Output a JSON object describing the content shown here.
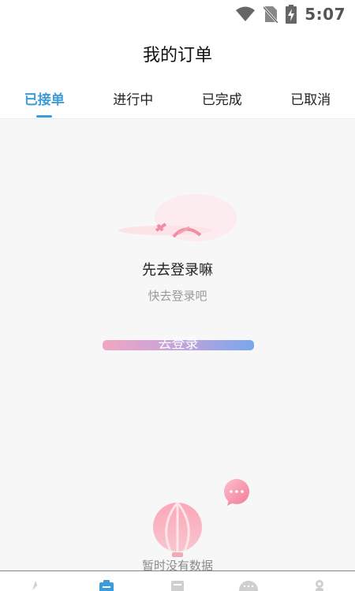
{
  "status_bar": {
    "time": "5:07",
    "icons": [
      "wifi-icon",
      "no-sim-icon",
      "battery-charging-icon"
    ]
  },
  "header": {
    "title": "我的订单"
  },
  "tabs": [
    {
      "label": "已接单",
      "active": true
    },
    {
      "label": "进行中",
      "active": false
    },
    {
      "label": "已完成",
      "active": false
    },
    {
      "label": "已取消",
      "active": false
    }
  ],
  "empty_state": {
    "title": "先去登录嘛",
    "subtitle": "快去登录吧",
    "button_label": "去登录",
    "no_data_text": "暂时没有数据"
  },
  "bottom_nav": {
    "items": [
      "home-icon",
      "orders-icon",
      "list-icon",
      "message-icon",
      "profile-icon"
    ],
    "active_index": 1
  },
  "colors": {
    "accent": "#3d9bd9",
    "button_gradient": [
      "#f1a6c0",
      "#7aa6ee"
    ],
    "illustration_pink": "#f7a1b5"
  }
}
